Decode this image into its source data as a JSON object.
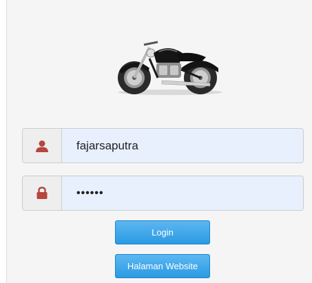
{
  "login": {
    "logo_icon": "motorcycle-icon",
    "username": {
      "icon": "user-icon",
      "value": "fajarsaputra"
    },
    "password": {
      "icon": "lock-icon",
      "masked_value": "••••••"
    },
    "login_button_label": "Login",
    "website_button_label": "Halaman Website",
    "colors": {
      "icon_red": "#b6463f",
      "button_blue": "#2b9ae3",
      "input_fill": "#e8f0fe"
    }
  }
}
